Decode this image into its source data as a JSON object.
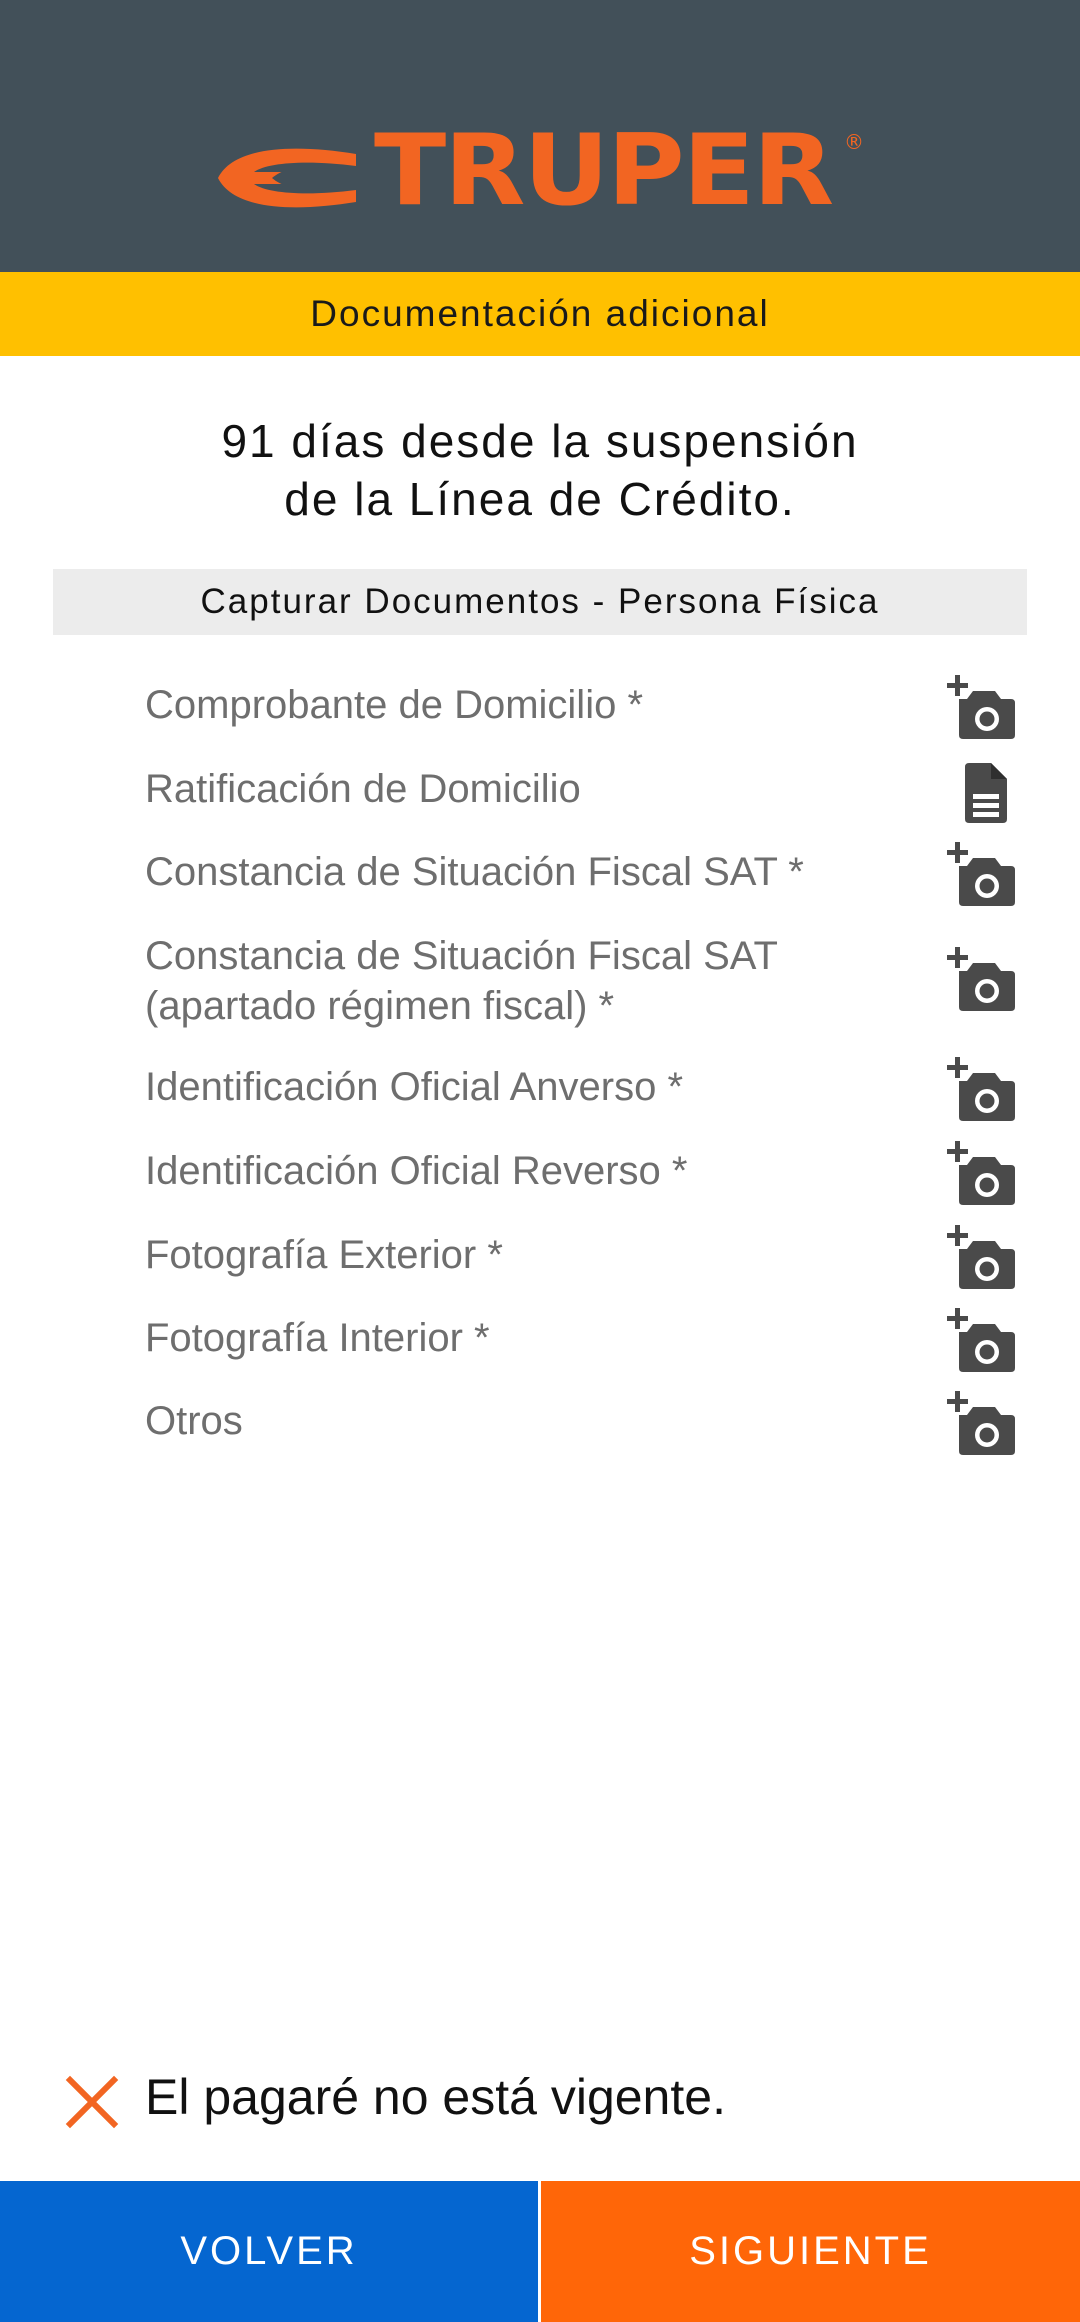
{
  "header": {
    "brand": "TRUPER",
    "registered": "®",
    "brand_color": "#f26522",
    "background": "#425059"
  },
  "subheader": {
    "title": "Documentación adicional",
    "background": "#ffc000"
  },
  "status": {
    "line1": "91 días desde la suspensión",
    "line2": "de la Línea de Crédito."
  },
  "section": {
    "title": "Capturar Documentos - Persona Física"
  },
  "documents": [
    {
      "label": "Comprobante de Domicilio *",
      "icon": "add-photo-icon"
    },
    {
      "label": "Ratificación de Domicilio",
      "icon": "document-icon"
    },
    {
      "label": "Constancia de Situación Fiscal SAT *",
      "icon": "add-photo-icon"
    },
    {
      "label_line1": "Constancia de Situación Fiscal SAT",
      "label_line2": "(apartado régimen fiscal) *",
      "icon": "add-photo-icon"
    },
    {
      "label": "Identificación Oficial Anverso *",
      "icon": "add-photo-icon"
    },
    {
      "label": "Identificación Oficial Reverso *",
      "icon": "add-photo-icon"
    },
    {
      "label": "Fotografía Exterior *",
      "icon": "add-photo-icon"
    },
    {
      "label": "Fotografía Interior *",
      "icon": "add-photo-icon"
    },
    {
      "label": "Otros",
      "icon": "add-photo-icon"
    }
  ],
  "warning": {
    "icon": "close-x-icon",
    "message": "El pagaré no está vigente.",
    "icon_color": "#f26522"
  },
  "footer": {
    "back_label": "VOLVER",
    "next_label": "SIGUIENTE",
    "back_color": "#0566d0",
    "next_color": "#ff6608"
  }
}
